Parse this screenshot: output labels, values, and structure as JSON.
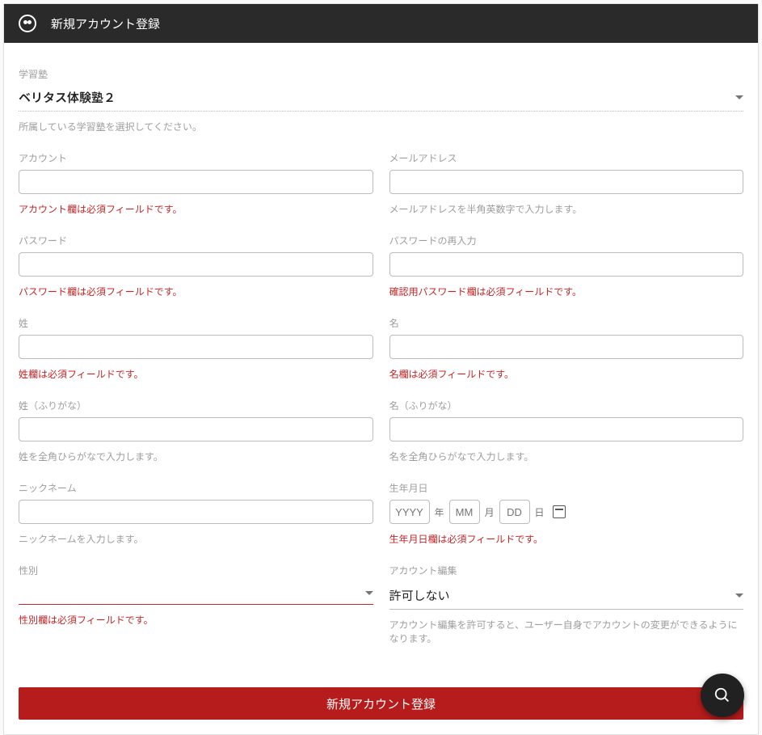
{
  "header": {
    "title": "新規アカウント登録"
  },
  "school": {
    "label": "学習塾",
    "value": "ベリタス体験塾２",
    "helper": "所属している学習塾を選択してください。"
  },
  "account": {
    "label": "アカウント",
    "error": "アカウント欄は必須フィールドです。"
  },
  "email": {
    "label": "メールアドレス",
    "helper": "メールアドレスを半角英数字で入力します。"
  },
  "password": {
    "label": "パスワード",
    "error": "パスワード欄は必須フィールドです。"
  },
  "password_confirm": {
    "label": "パスワードの再入力",
    "error": "確認用パスワード欄は必須フィールドです。"
  },
  "last_name": {
    "label": "姓",
    "error": "姓欄は必須フィールドです。"
  },
  "first_name": {
    "label": "名",
    "error": "名欄は必須フィールドです。"
  },
  "last_name_kana": {
    "label": "姓（ふりがな）",
    "helper": "姓を全角ひらがなで入力します。"
  },
  "first_name_kana": {
    "label": "名（ふりがな）",
    "helper": "名を全角ひらがなで入力します。"
  },
  "nickname": {
    "label": "ニックネーム",
    "helper": "ニックネームを入力します。"
  },
  "birthday": {
    "label": "生年月日",
    "yyyy_placeholder": "YYYY",
    "mm_placeholder": "MM",
    "dd_placeholder": "DD",
    "year_unit": "年",
    "month_unit": "月",
    "day_unit": "日",
    "error": "生年月日欄は必須フィールドです。"
  },
  "gender": {
    "label": "性別",
    "value": "",
    "error": "性別欄は必須フィールドです。"
  },
  "account_edit": {
    "label": "アカウント編集",
    "value": "許可しない",
    "helper": "アカウント編集を許可すると、ユーザー自身でアカウントの変更ができるようになります。"
  },
  "submit": {
    "label": "新規アカウント登録"
  }
}
